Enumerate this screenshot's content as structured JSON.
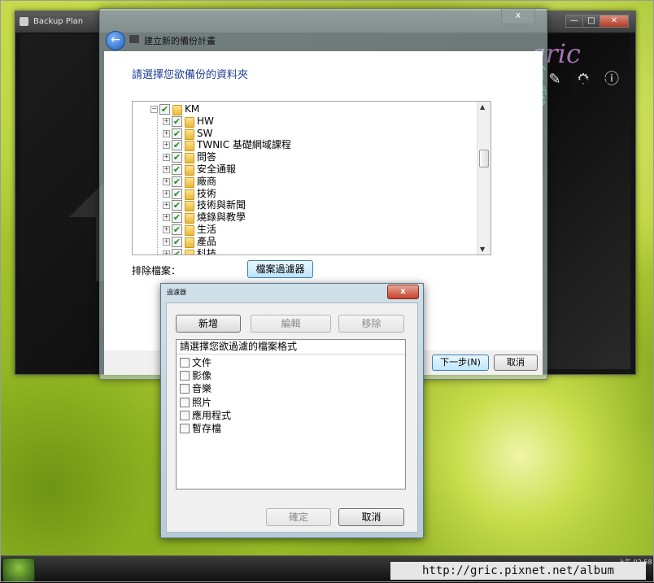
{
  "background_window": {
    "title": "Backup Plan",
    "controls": {
      "minimize": "—",
      "maximize": "□",
      "close": "✕"
    },
    "icons": [
      "pen-icon",
      "gear-icon",
      "info-icon"
    ]
  },
  "watermark": {
    "text": "gric",
    "kanji": "熊",
    "sub": "台\n灣"
  },
  "wizard": {
    "close_glyph": "x",
    "nav_title": "建立新的備份計畫",
    "heading": "請選擇您欲備份的資料夾",
    "tree": {
      "root": "KM",
      "children": [
        "HW",
        "SW",
        "TWNIC 基礎網域課程",
        "問答",
        "安全通報",
        "廠商",
        "技術",
        "技術與新聞",
        "燒錄與教學",
        "生活",
        "產品",
        "科技"
      ]
    },
    "exclude_label": "排除檔案：",
    "filter_button": "檔案過濾器",
    "next_button": "下一步(N)",
    "cancel_button": "取消"
  },
  "filter_dialog": {
    "title": "過濾器",
    "close_glyph": "x",
    "add_button": "新增",
    "edit_button": "編輯",
    "remove_button": "移除",
    "list_header": "請選擇您欲過濾的檔案格式",
    "items": [
      "文件",
      "影像",
      "音樂",
      "照片",
      "應用程式",
      "暫存檔"
    ],
    "ok_button": "確定",
    "cancel_button": "取消"
  },
  "taskbar": {
    "clock": "上午 02:58"
  },
  "footer_url": "http://gric.pixnet.net/album",
  "colors": {
    "heading": "#1f3f99",
    "check": "#1a8f1a",
    "close_red": "#c4412a"
  }
}
